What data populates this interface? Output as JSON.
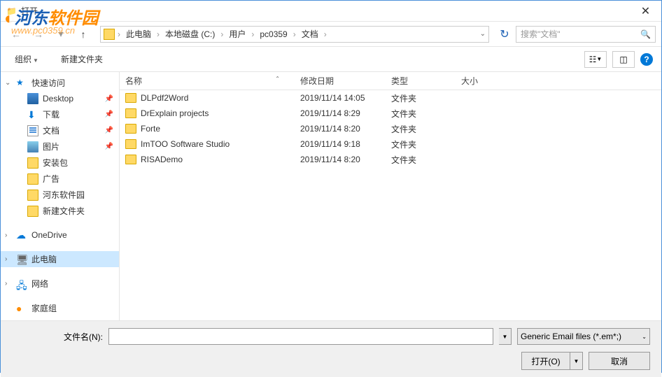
{
  "window": {
    "title": "打开"
  },
  "watermark": {
    "text_prefix": "河东",
    "text_suffix": "软件园",
    "url": "www.pc0359.cn"
  },
  "breadcrumb": {
    "items": [
      "此电脑",
      "本地磁盘 (C:)",
      "用户",
      "pc0359",
      "文档"
    ]
  },
  "search": {
    "placeholder": "搜索\"文档\""
  },
  "toolbar": {
    "organize": "组织",
    "new_folder": "新建文件夹"
  },
  "sidebar": {
    "quick_access": "快速访问",
    "items": [
      {
        "label": "Desktop",
        "icon": "desktop",
        "pinned": true
      },
      {
        "label": "下载",
        "icon": "download",
        "pinned": true
      },
      {
        "label": "文档",
        "icon": "doc",
        "pinned": true,
        "selected": true
      },
      {
        "label": "图片",
        "icon": "pic",
        "pinned": true
      },
      {
        "label": "安装包",
        "icon": "folder"
      },
      {
        "label": "广告",
        "icon": "folder"
      },
      {
        "label": "河东软件园",
        "icon": "folder"
      },
      {
        "label": "新建文件夹",
        "icon": "folder"
      }
    ],
    "onedrive": "OneDrive",
    "this_pc": "此电脑",
    "network": "网络",
    "homegroup": "家庭组"
  },
  "columns": {
    "name": "名称",
    "date": "修改日期",
    "type": "类型",
    "size": "大小"
  },
  "files": [
    {
      "name": "DLPdf2Word",
      "date": "2019/11/14 14:05",
      "type": "文件夹"
    },
    {
      "name": "DrExplain projects",
      "date": "2019/11/14 8:29",
      "type": "文件夹"
    },
    {
      "name": "Forte",
      "date": "2019/11/14 8:20",
      "type": "文件夹"
    },
    {
      "name": "ImTOO Software Studio",
      "date": "2019/11/14 9:18",
      "type": "文件夹"
    },
    {
      "name": "RISADemo",
      "date": "2019/11/14 8:20",
      "type": "文件夹"
    }
  ],
  "footer": {
    "filename_label": "文件名(N):",
    "filename_value": "",
    "filetype": "Generic Email files (*.em*;)",
    "open": "打开(O)",
    "cancel": "取消"
  }
}
